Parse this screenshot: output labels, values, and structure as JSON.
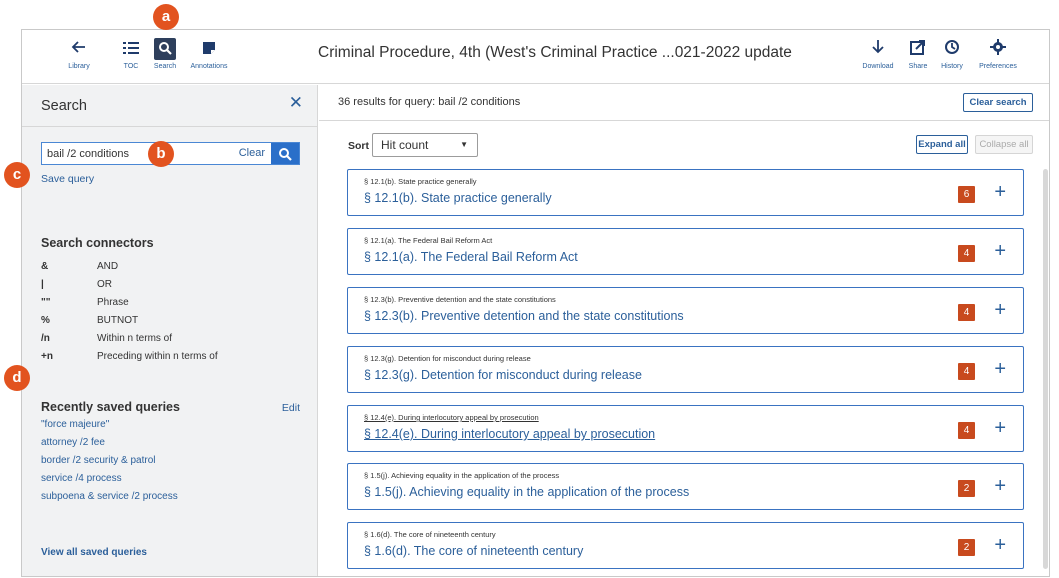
{
  "toolbar": {
    "library": "Library",
    "toc": "TOC",
    "search": "Search",
    "annotations": "Annotations",
    "doc_title": "Criminal Procedure, 4th (West's Criminal Practice ...021-2022 update",
    "download": "Download",
    "share": "Share",
    "history": "History",
    "preferences": "Preferences"
  },
  "search_panel": {
    "title": "Search",
    "query_value": "bail /2 conditions",
    "clear_label": "Clear",
    "save_query": "Save query",
    "connectors_title": "Search connectors",
    "connectors": [
      {
        "symbol": "&",
        "meaning": "AND"
      },
      {
        "symbol": "|",
        "meaning": "OR"
      },
      {
        "symbol": "\"\"",
        "meaning": "Phrase"
      },
      {
        "symbol": "%",
        "meaning": "BUTNOT"
      },
      {
        "symbol": "/n",
        "meaning": "Within n terms of"
      },
      {
        "symbol": "+n",
        "meaning": "Preceding within n terms of"
      }
    ],
    "recent_title": "Recently saved queries",
    "edit_label": "Edit",
    "recent_queries": [
      "\"force majeure\"",
      "attorney /2 fee",
      "border /2 security  &  patrol",
      "service /4 process",
      "subpoena  &  service /2 process"
    ],
    "view_all": "View all saved queries"
  },
  "results": {
    "summary": "36 results for query:  bail /2 conditions",
    "clear_search": "Clear search",
    "sort_label": "Sort",
    "sort_value": "Hit count",
    "expand_all": "Expand all",
    "collapse_all": "Collapse all",
    "items": [
      {
        "small": "§ 12.1(b). State practice generally",
        "link": "§ 12.1(b). State practice generally",
        "count": "6"
      },
      {
        "small": "§ 12.1(a). The Federal Bail Reform Act",
        "link": "§ 12.1(a). The Federal Bail Reform Act",
        "count": "4"
      },
      {
        "small": "§ 12.3(b). Preventive detention and the state constitutions",
        "link": "§ 12.3(b). Preventive detention and the state constitutions",
        "count": "4"
      },
      {
        "small": "§ 12.3(g). Detention for misconduct during release",
        "link": "§ 12.3(g). Detention for misconduct during release",
        "count": "4"
      },
      {
        "small": "§ 12.4(e). During interlocutory appeal by prosecution",
        "link": "§ 12.4(e). During interlocutory appeal by prosecution",
        "count": "4"
      },
      {
        "small": "§ 1.5(j). Achieving equality in the application of the process",
        "link": "§ 1.5(j). Achieving equality in the application of the process",
        "count": "2"
      },
      {
        "small": "§ 1.6(d). The core of nineteenth century",
        "link": "§ 1.6(d). The core of nineteenth century",
        "count": "2"
      }
    ]
  },
  "markers": {
    "a": "a",
    "b": "b",
    "c": "c",
    "d": "d"
  },
  "colors": {
    "accent": "#2b5f9a",
    "badge": "#c84a1e",
    "marker": "#e2531f",
    "panel": "#f1f2f3"
  }
}
